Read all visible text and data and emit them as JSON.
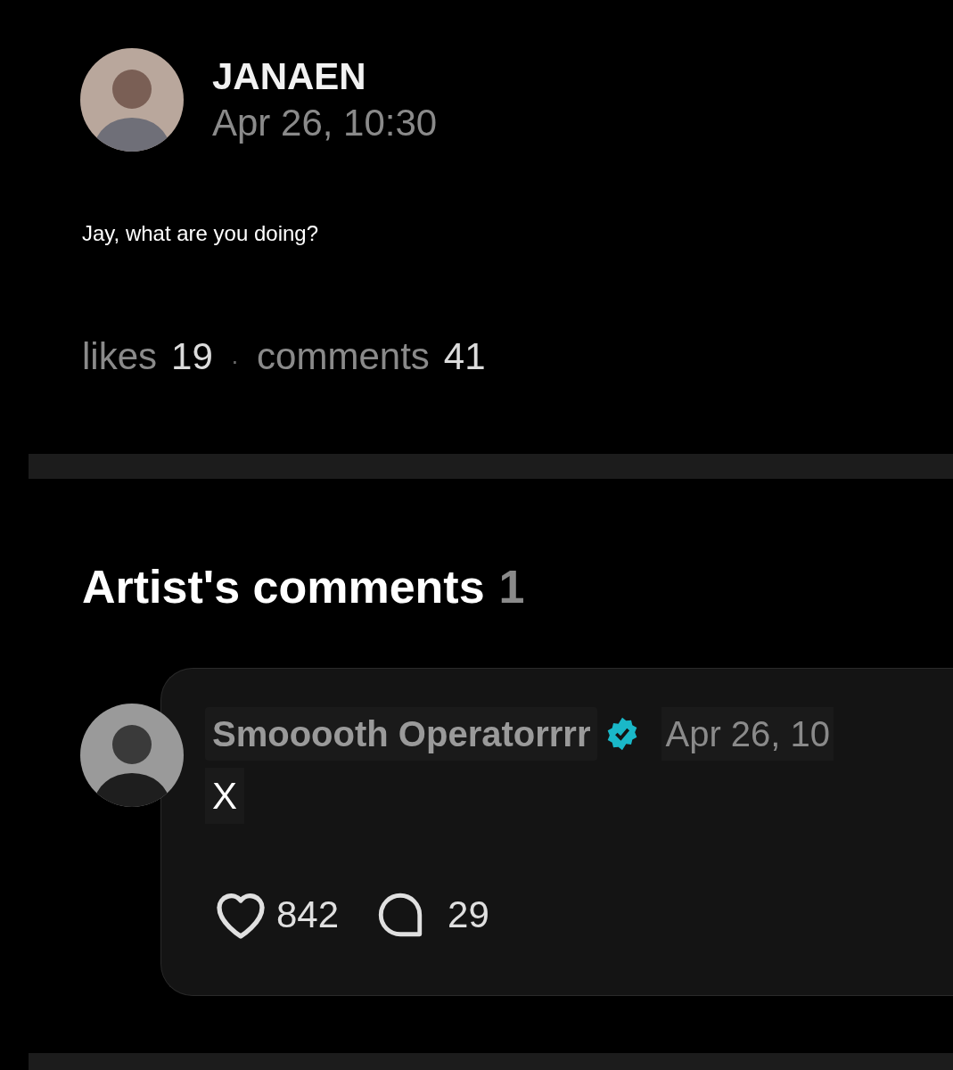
{
  "post": {
    "author": "JANAEN",
    "date": "Apr 26, 10:30",
    "text": "Jay, what are you doing?",
    "stats": [
      {
        "label": "likes",
        "count": "19"
      },
      {
        "label": "comments",
        "count": "41"
      }
    ],
    "separator": "·"
  },
  "artist_comments": {
    "title": "Artist's comments",
    "count": "1",
    "items": [
      {
        "author": "Smooooth Operatorrrr",
        "verified": true,
        "date": "Apr 26, 10",
        "text": "X",
        "likes": "842",
        "replies": "29"
      }
    ]
  }
}
